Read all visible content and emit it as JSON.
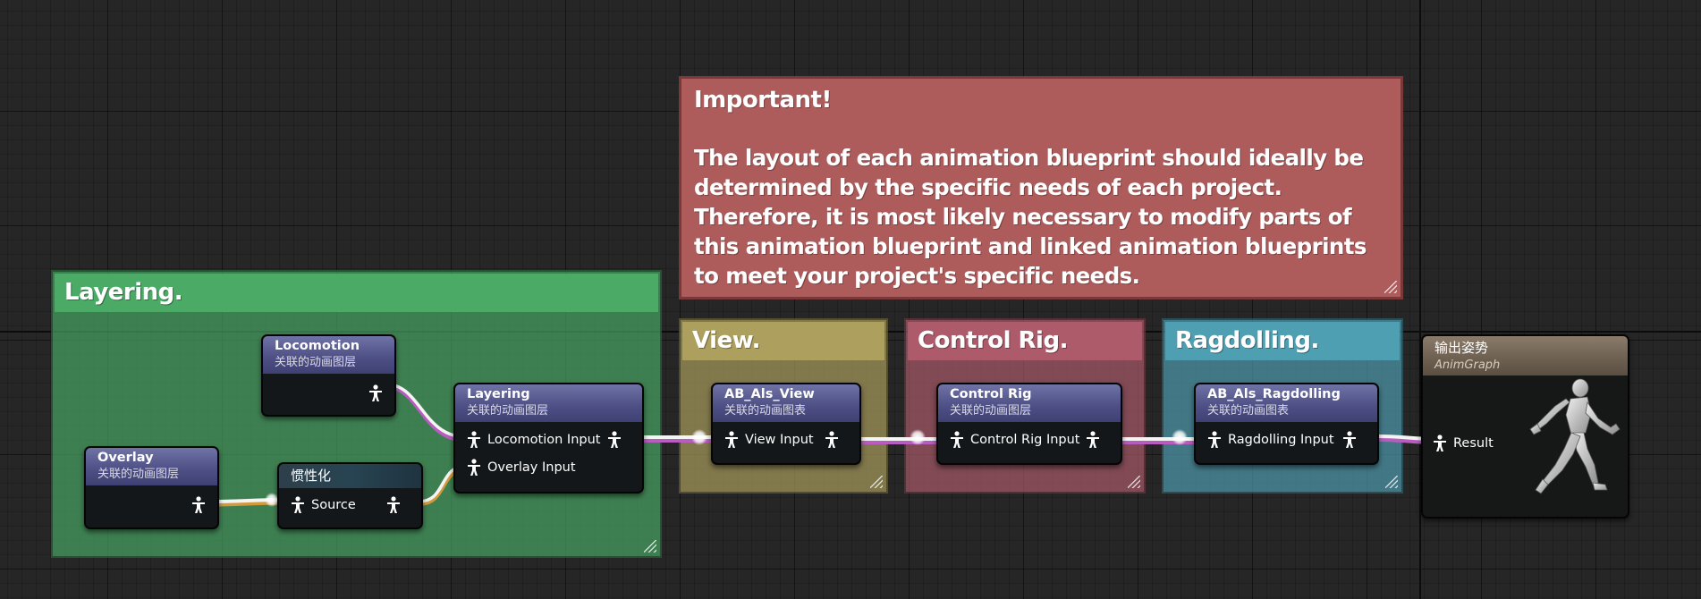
{
  "comments": {
    "layering": {
      "title": "Layering.",
      "color": "#4aaa66"
    },
    "view": {
      "title": "View.",
      "color": "#ad9f5e"
    },
    "control_rig": {
      "title": "Control Rig.",
      "color": "#ad5b6b"
    },
    "ragdolling": {
      "title": "Ragdolling.",
      "color": "#4f9fb2"
    }
  },
  "note": {
    "title": "Important!",
    "body": "The layout of each animation blueprint should ideally be determined by the specific needs of each project. Therefore, it is most likely necessary to modify parts of this animation blueprint and linked animation blueprints to meet your project's specific needs.",
    "color": "#ad5b5b"
  },
  "nodes": {
    "locomotion": {
      "title": "Locomotion",
      "subtitle": "关联的动画图层"
    },
    "overlay": {
      "title": "Overlay",
      "subtitle": "关联的动画图层"
    },
    "inertialization": {
      "title": "惯性化",
      "source_label": "Source"
    },
    "layering": {
      "title": "Layering",
      "subtitle": "关联的动画图层",
      "input_1": "Locomotion Input",
      "input_2": "Overlay Input"
    },
    "view": {
      "title": "AB_Als_View",
      "subtitle": "关联的动画图表",
      "input": "View Input"
    },
    "control_rig": {
      "title": "Control Rig",
      "subtitle": "关联的动画图层",
      "input": "Control Rig Input"
    },
    "ragdolling": {
      "title": "AB_Als_Ragdolling",
      "subtitle": "关联的动画图表",
      "input": "Ragdolling Input"
    },
    "output_pose": {
      "title": "输出姿势",
      "subtitle": "AnimGraph",
      "result_label": "Result"
    }
  },
  "icons": {
    "pose_pin": "pose-pin-icon",
    "mannequin": "running-mannequin-icon"
  }
}
